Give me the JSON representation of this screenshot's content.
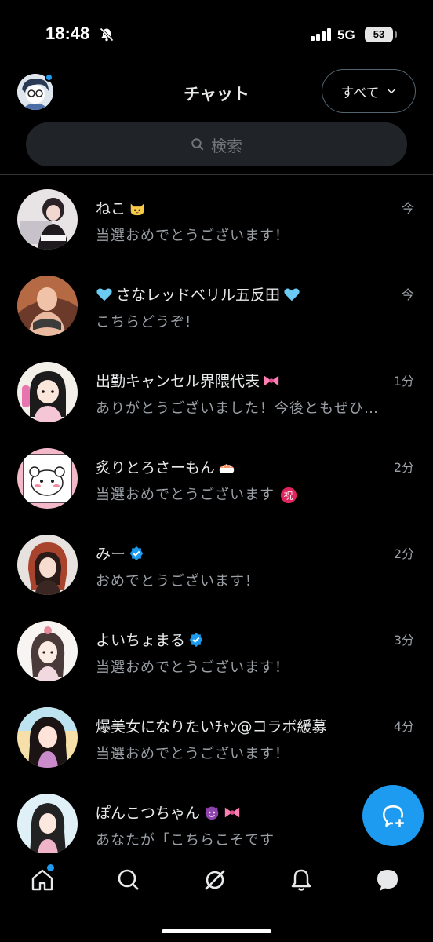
{
  "status_bar": {
    "time": "18:48",
    "network": "5G",
    "battery": "53"
  },
  "header": {
    "title": "チャット",
    "filter_label": "すべて"
  },
  "search": {
    "placeholder": "検索"
  },
  "chats": [
    {
      "name": "ねこ",
      "name_suffix_icon": "cat-emoji-icon",
      "preview": "当選おめでとうございます！",
      "time": "今"
    },
    {
      "name": "さなレッドベリル五反田",
      "name_suffix_icon": "light-blue-heart-emoji-icon",
      "preview": "こちらどうぞ!",
      "time": "今"
    },
    {
      "name": "出勤キャンセル界隈代表",
      "name_suffix_icon": "ribbon-emoji-icon",
      "preview": "ありがとうございました！今後ともぜひ…",
      "time": "1分"
    },
    {
      "name": "炙りとろさーもん",
      "name_suffix_icon": "sushi-emoji-icon",
      "preview": "当選おめでとうございます",
      "preview_suffix_icon": "celebration-emoji-icon",
      "time": "2分"
    },
    {
      "name": "みー",
      "name_suffix_icon": "verified-badge-icon",
      "preview": "おめでとうございます！",
      "time": "2分"
    },
    {
      "name": "よいちょまる",
      "name_suffix_icon": "verified-badge-icon",
      "preview": "当選おめでとうございます！",
      "time": "3分"
    },
    {
      "name": "爆美女になりたいﾁｬﾝ@コラボ緩募",
      "preview": "当選おめでとうございます！",
      "time": "4分"
    },
    {
      "name": "ぽんこつちゃん",
      "name_suffix_icon": "devil-and-ribbon-emoji-icon",
      "preview": "あなたが「こちらこそです",
      "time": ""
    }
  ],
  "fab": {
    "icon": "new-message-icon"
  },
  "nav": [
    "home-icon",
    "search-icon",
    "grok-icon",
    "notifications-icon",
    "messages-icon"
  ],
  "colors": {
    "accent": "#1d9bf0",
    "background": "#000000",
    "text": "#e7e9ea",
    "muted": "#9aa0a6"
  }
}
